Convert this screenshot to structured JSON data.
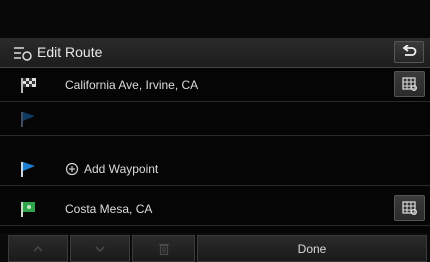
{
  "header": {
    "title": "Edit Route",
    "title_icon": "edit-route-icon",
    "back_icon": "back-arrow-icon"
  },
  "route": {
    "rows": [
      {
        "label": "California Ave, Irvine, CA",
        "flag": "checkered-flag-icon",
        "has_map_button": true
      },
      {
        "label": "",
        "flag": "blue-flag-icon",
        "has_map_button": false
      },
      {
        "label": "Add Waypoint",
        "flag": "blue-flag-icon",
        "has_map_button": false,
        "add_icon": "plus-circle-icon"
      },
      {
        "label": "Costa Mesa, CA",
        "flag": "green-flag-icon",
        "has_map_button": true
      }
    ]
  },
  "footer": {
    "up_icon": "chevron-up-icon",
    "down_icon": "chevron-down-icon",
    "delete_icon": "trash-icon",
    "done_label": "Done"
  },
  "colors": {
    "background": "#050505",
    "header": "#262626",
    "blue_flag": "#1e7fd6",
    "green_flag": "#2fa44a"
  }
}
